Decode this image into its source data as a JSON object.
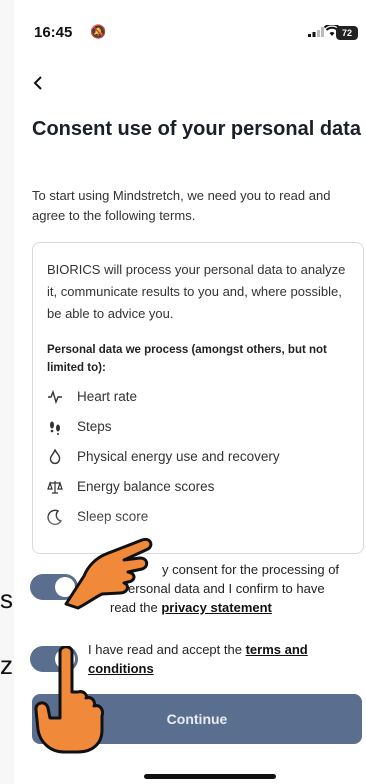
{
  "status_bar": {
    "time": "16:45",
    "battery": "72"
  },
  "header": {
    "title": "Consent use of your personal data"
  },
  "intro": "To start using Mindstretch, we need you to read and agree to the following terms.",
  "terms_box": {
    "intro": "BIORICS will process your personal data to analyze it, communicate results to you and, where possible, be able to advice you.",
    "data_heading": "Personal data we process (amongst others, but not limited to):",
    "items": [
      {
        "label": "Heart rate",
        "icon": "heart-rate-icon"
      },
      {
        "label": "Steps",
        "icon": "steps-icon"
      },
      {
        "label": "Physical energy use and recovery",
        "icon": "energy-icon"
      },
      {
        "label": "Energy balance scores",
        "icon": "balance-icon"
      },
      {
        "label": "Sleep score",
        "icon": "sleep-icon"
      }
    ]
  },
  "consent_privacy": {
    "text_before": "y consent for the processing of",
    "text_line2": "ersonal data and I confirm to have",
    "text_line3": "read the",
    "link": "privacy statement",
    "toggle_on": true
  },
  "consent_terms": {
    "text": "I have read and accept the",
    "link": "terms and conditions",
    "toggle_on": true
  },
  "continue_label": "Continue",
  "side_letters": [
    "s",
    "z"
  ],
  "colors": {
    "accent": "#5a6f8f",
    "hand": "#f08a3a"
  }
}
